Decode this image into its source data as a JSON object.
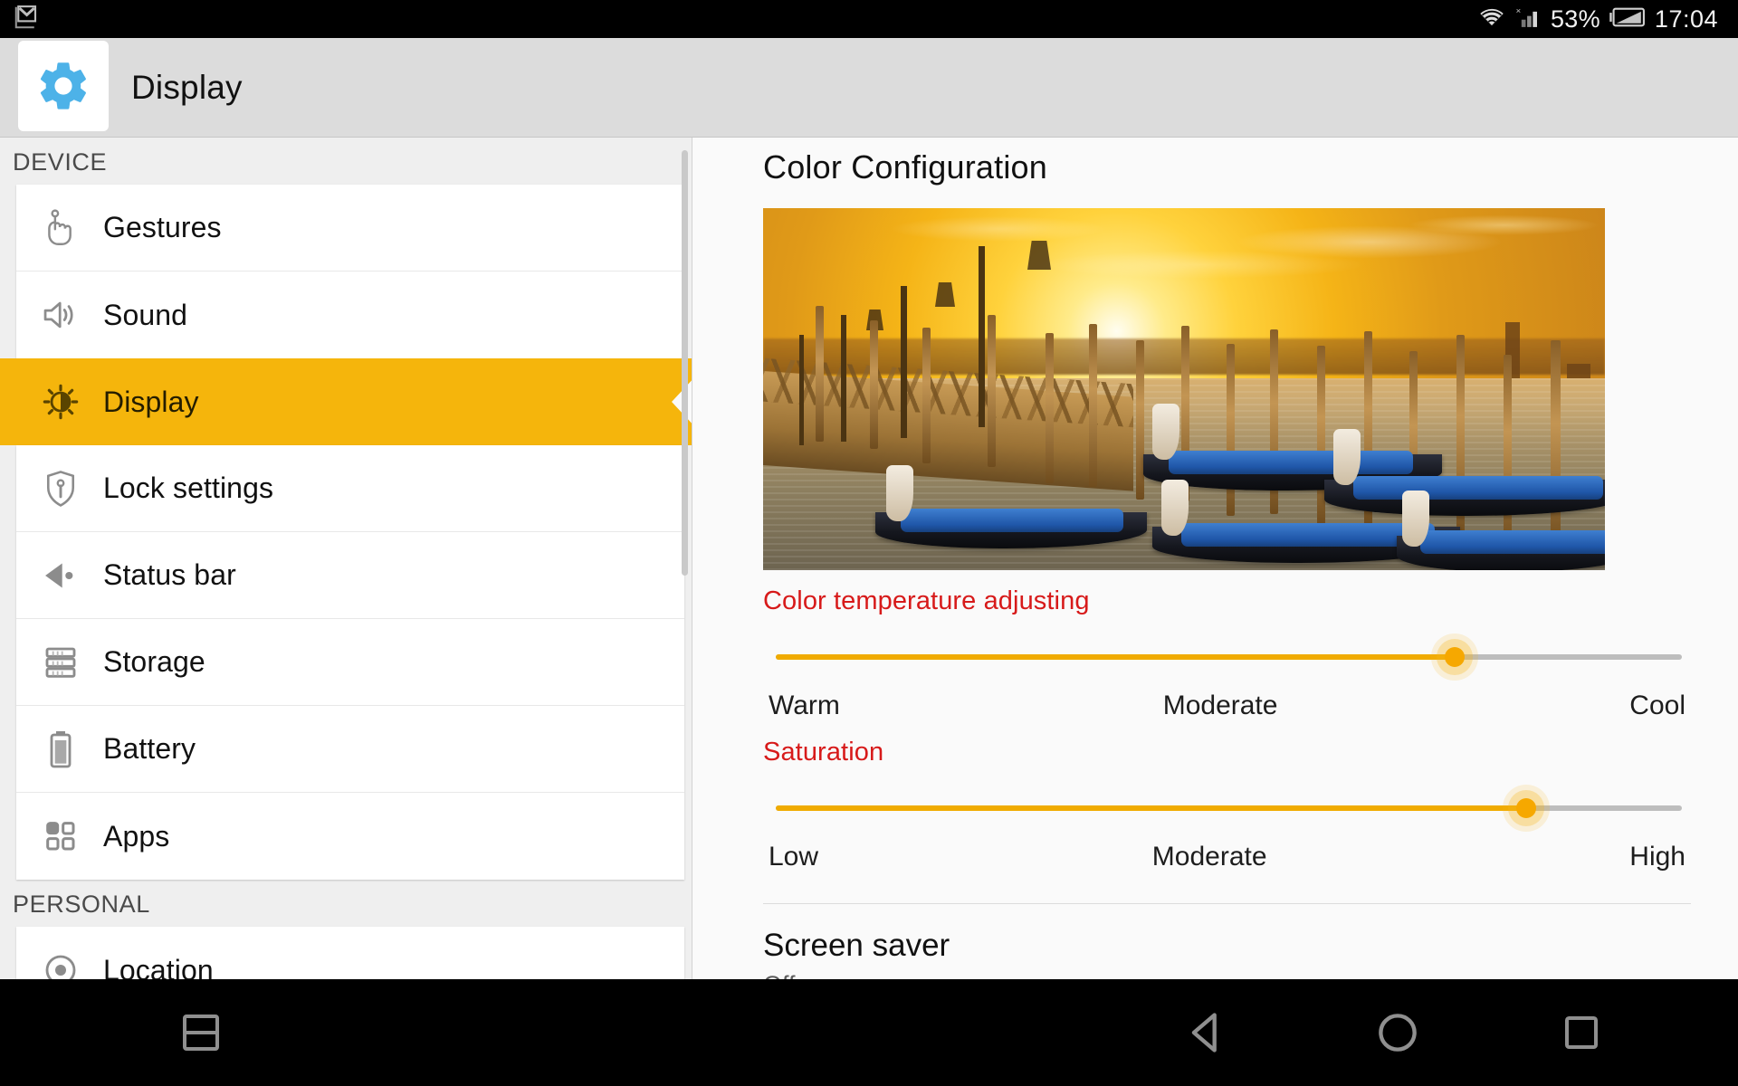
{
  "statusbar": {
    "notification_icon": "gmail-icon",
    "wifi_icon": "wifi-icon",
    "signal_icon": "cell-signal-no-service-icon",
    "battery_percent": "53%",
    "battery_icon": "battery-icon",
    "clock": "17:04"
  },
  "appbar": {
    "icon": "settings-gear-icon",
    "title": "Display"
  },
  "sidebar": {
    "sections": [
      {
        "header": "DEVICE",
        "items": [
          {
            "label": "Gestures",
            "icon": "hand-tap-icon",
            "selected": false
          },
          {
            "label": "Sound",
            "icon": "speaker-icon",
            "selected": false
          },
          {
            "label": "Display",
            "icon": "brightness-sun-icon",
            "selected": true
          },
          {
            "label": "Lock settings",
            "icon": "shield-lock-icon",
            "selected": false
          },
          {
            "label": "Status bar",
            "icon": "back-arrow-dot-icon",
            "selected": false
          },
          {
            "label": "Storage",
            "icon": "storage-stack-icon",
            "selected": false
          },
          {
            "label": "Battery",
            "icon": "battery-vertical-icon",
            "selected": false
          },
          {
            "label": "Apps",
            "icon": "apps-grid-icon",
            "selected": false
          }
        ]
      },
      {
        "header": "PERSONAL",
        "items": [
          {
            "label": "Location",
            "icon": "location-target-icon",
            "selected": false
          }
        ]
      }
    ]
  },
  "panel": {
    "title": "Color Configuration",
    "preview_image_alt": "venice-gondolas-sunset-photo",
    "sliders": [
      {
        "label": "Color temperature adjusting",
        "label_color": "#d71a1a",
        "value_percent": 75,
        "scale_left": "Warm",
        "scale_mid": "Moderate",
        "scale_right": "Cool"
      },
      {
        "label": "Saturation",
        "label_color": "#d71a1a",
        "value_percent": 83,
        "scale_left": "Low",
        "scale_mid": "Moderate",
        "scale_right": "High"
      }
    ],
    "screen_saver": {
      "title": "Screen saver",
      "value": "Off"
    }
  },
  "navbar": {
    "split_screen": "split-screen-icon",
    "back": "back-triangle-icon",
    "home": "home-circle-icon",
    "recents": "recents-square-icon"
  },
  "colors": {
    "accent": "#f5b50c",
    "slider_fill": "#f0ab00",
    "label_red": "#d71a1a",
    "appbar_bg": "#dcdcdc",
    "gear_blue": "#4db2e8"
  }
}
